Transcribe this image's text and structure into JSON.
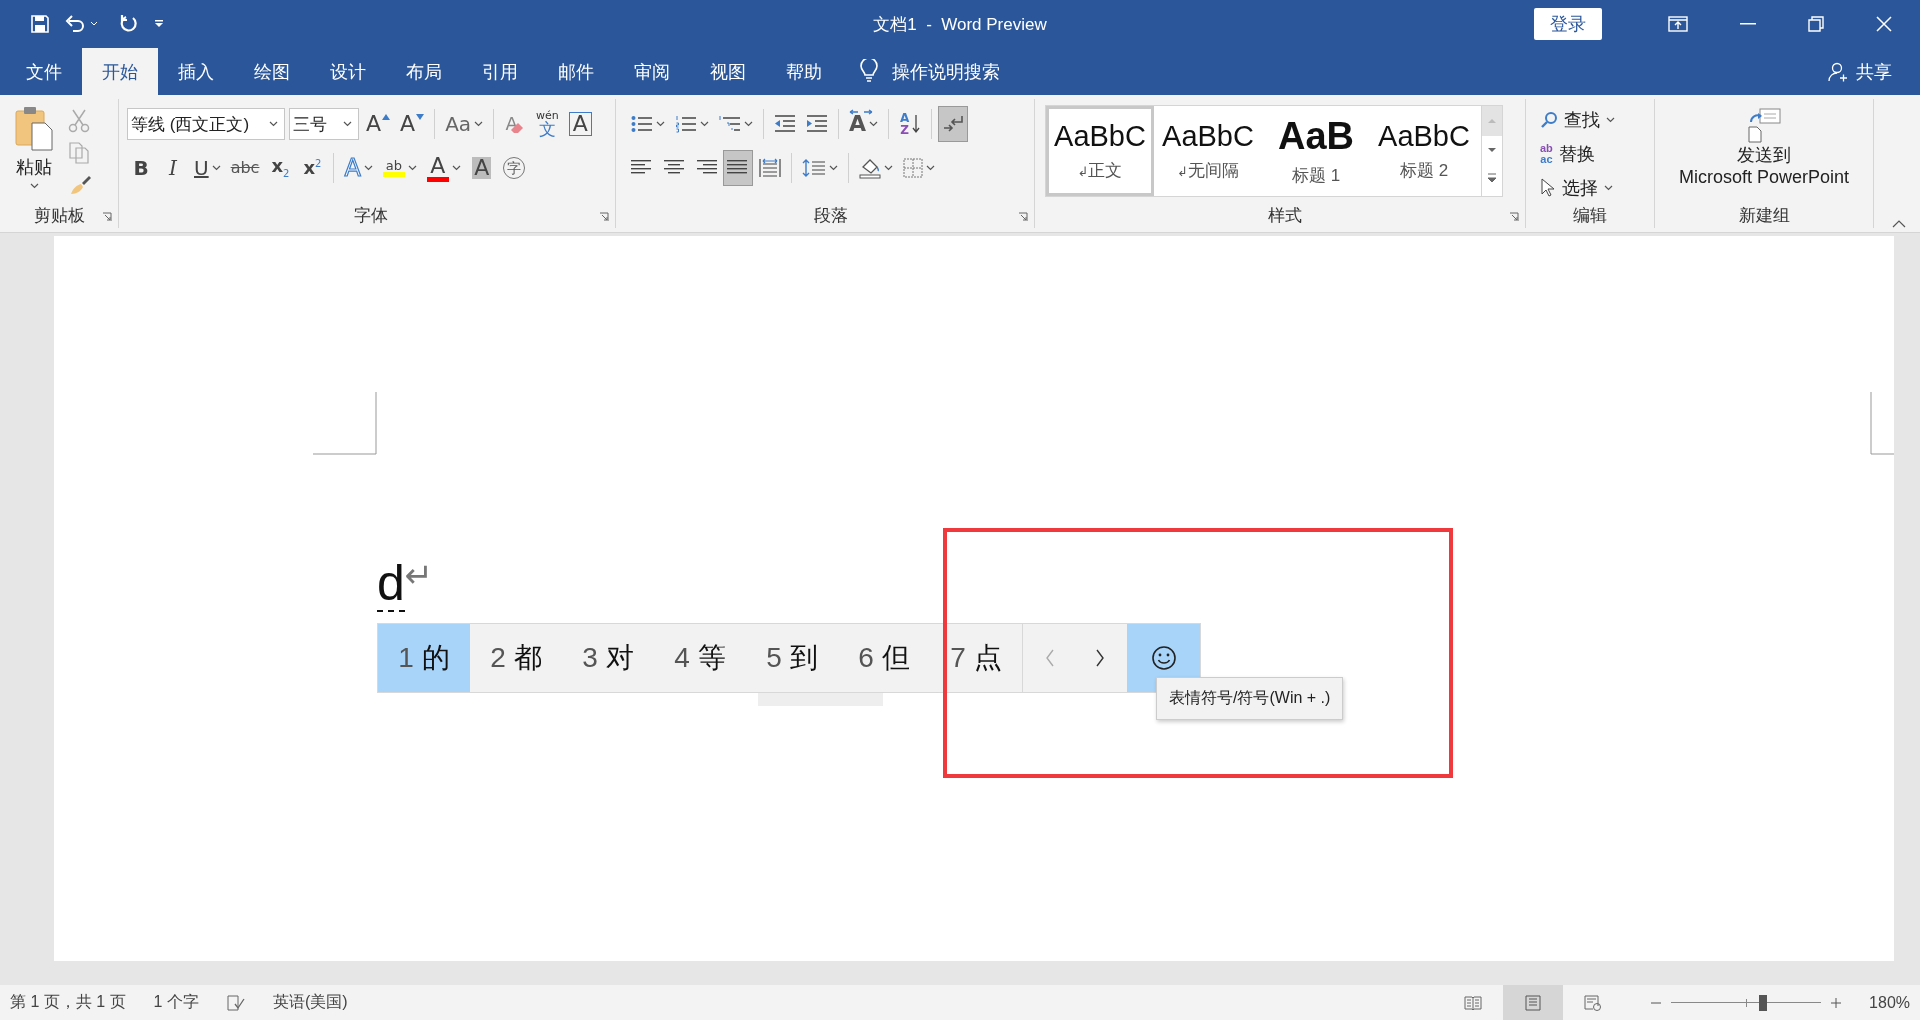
{
  "window": {
    "title": "文档1  -  Word Preview",
    "sign_in": "登录"
  },
  "ribbon_tabs": [
    {
      "label": "文件",
      "selected": false
    },
    {
      "label": "开始",
      "selected": true
    },
    {
      "label": "插入",
      "selected": false
    },
    {
      "label": "绘图",
      "selected": false
    },
    {
      "label": "设计",
      "selected": false
    },
    {
      "label": "布局",
      "selected": false
    },
    {
      "label": "引用",
      "selected": false
    },
    {
      "label": "邮件",
      "selected": false
    },
    {
      "label": "审阅",
      "selected": false
    },
    {
      "label": "视图",
      "selected": false
    },
    {
      "label": "帮助",
      "selected": false
    }
  ],
  "tell_me": "操作说明搜索",
  "share": "共享",
  "clipboard": {
    "paste": "粘贴",
    "label": "剪贴板"
  },
  "font": {
    "name": "等线 (西文正文)",
    "size": "三号",
    "label": "字体",
    "row1": [
      {
        "kind": "grow",
        "glyph": "A"
      },
      {
        "kind": "shrink",
        "glyph": "A"
      },
      {
        "kind": "case",
        "glyph": "Aa",
        "dropdown": true
      },
      {
        "kind": "clear",
        "glyph": "A"
      },
      {
        "kind": "phonetic",
        "glyph": "wén",
        "glyph2": "文"
      },
      {
        "kind": "border",
        "glyph": "A"
      }
    ],
    "row2": [
      {
        "kind": "bold",
        "glyph": "B"
      },
      {
        "kind": "italic",
        "glyph": "I"
      },
      {
        "kind": "underline",
        "glyph": "U",
        "dropdown": true
      },
      {
        "kind": "strike",
        "glyph": "abc"
      },
      {
        "kind": "subscript",
        "glyph": "x$_{2}$"
      },
      {
        "kind": "superscript",
        "glyph": "x$^{2}$"
      },
      {
        "kind": "effects",
        "glyph": "A",
        "dropdown": true
      },
      {
        "kind": "highlight",
        "glyph": "ab",
        "color": "#ffff00",
        "dropdown": true
      },
      {
        "kind": "color",
        "glyph": "A",
        "color": "#ff0000",
        "dropdown": true
      },
      {
        "kind": "shading",
        "glyph": "A"
      },
      {
        "kind": "enclose",
        "glyph": "字"
      }
    ]
  },
  "paragraph": {
    "label": "段落",
    "row1": [
      {
        "kind": "bullets",
        "dropdown": true
      },
      {
        "kind": "numbering",
        "dropdown": true
      },
      {
        "kind": "multilevel",
        "dropdown": true
      },
      {
        "kind": "outdent"
      },
      {
        "kind": "indent"
      },
      {
        "kind": "asian",
        "glyph": "A",
        "dropdown": true
      },
      {
        "kind": "sort",
        "glyph": "A",
        "glyph2": "Z"
      },
      {
        "kind": "marks",
        "selected": true
      }
    ],
    "row2": [
      {
        "kind": "left",
        "selected": false
      },
      {
        "kind": "center",
        "selected": false
      },
      {
        "kind": "right",
        "selected": false
      },
      {
        "kind": "justify",
        "selected": true
      },
      {
        "kind": "distributed",
        "selected": false
      },
      {
        "kind": "spacing",
        "dropdown": true
      },
      {
        "kind": "fill",
        "dropdown": true
      },
      {
        "kind": "borders",
        "dropdown": true
      }
    ]
  },
  "styles": {
    "label": "样式",
    "items": [
      {
        "kind": "normal",
        "sample": "AaBbC",
        "mark": "↲",
        "name": "正文",
        "selected": true
      },
      {
        "kind": "normal",
        "sample": "AaBbC",
        "mark": "↲",
        "name": "无间隔",
        "selected": false
      },
      {
        "kind": "heading1",
        "sample": "AaB",
        "name": "标题 1",
        "selected": false
      },
      {
        "kind": "heading2",
        "sample": "AaBbC",
        "name": "标题 2",
        "selected": false
      }
    ]
  },
  "editing": {
    "label": "编辑",
    "find": "查找",
    "replace": "替换",
    "replace_glyph": "ab",
    "replace_glyph2": "ac",
    "select": "选择"
  },
  "new_group": {
    "label": "新建组",
    "button": [
      "发送到",
      "Microsoft PowerPoint"
    ]
  },
  "document": {
    "text": "d",
    "para_mark": "↵"
  },
  "ime": {
    "candidates": [
      {
        "index": "1",
        "text": "的",
        "selected": true
      },
      {
        "index": "2",
        "text": "都",
        "selected": false
      },
      {
        "index": "3",
        "text": "对",
        "selected": false
      },
      {
        "index": "4",
        "text": "等",
        "selected": false
      },
      {
        "index": "5",
        "text": "到",
        "selected": false
      },
      {
        "index": "6",
        "text": "但",
        "selected": false
      },
      {
        "index": "7",
        "text": "点",
        "selected": false
      }
    ],
    "emoji_hovered": true,
    "tooltip": "表情符号/符号(Win + .)"
  },
  "annotation": {
    "kind": "rectangle"
  },
  "status_bar": {
    "page": "第 1 页，共 1 页",
    "words": "1 个字",
    "language": "英语(美国)",
    "views": [
      {
        "kind": "read",
        "selected": false
      },
      {
        "kind": "print",
        "selected": true
      },
      {
        "kind": "web",
        "selected": false
      }
    ],
    "zoom": {
      "level": 0.61,
      "reading": "180%"
    }
  }
}
